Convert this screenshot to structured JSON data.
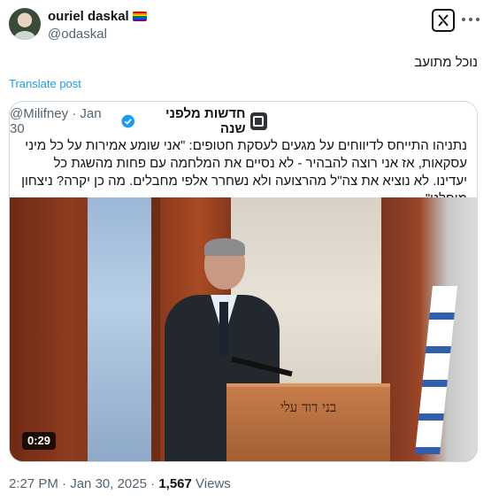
{
  "author": {
    "name": "ouriel daskal",
    "handle": "@odaskal",
    "flag_colors": [
      "#e40303",
      "#ff8c00",
      "#ffed00",
      "#008026",
      "#004dff",
      "#750787"
    ]
  },
  "post": {
    "text": "נוכל מתועב",
    "translate_label": "Translate post"
  },
  "quoted": {
    "name": "חדשות מלפני שנה",
    "handle": "@Milifney",
    "separator": "·",
    "date": "Jan 30",
    "text": "נתניהו התייחס לדיווחים על מגעים לעסקת חטופים: \"אני שומע אמירות על כל מיני עסקאות, אז אני רוצה להבהיר - לא נסיים את המלחמה עם פחות מהשגת כל יעדינו. לא נוציא את צה\"ל מהרצועה ולא נשחרר אלפי מחבלים. מה כן יקרה? ניצחון מוחלט\"",
    "video_duration": "0:29",
    "podium_text": "בני דוד עלי"
  },
  "meta": {
    "time": "2:27 PM",
    "separator": "·",
    "date": "Jan 30, 2025",
    "views_count": "1,567",
    "views_label": "Views"
  },
  "colors": {
    "link": "#1d9bf0",
    "verified": "#1d9bf0",
    "secondary_text": "#536471"
  }
}
